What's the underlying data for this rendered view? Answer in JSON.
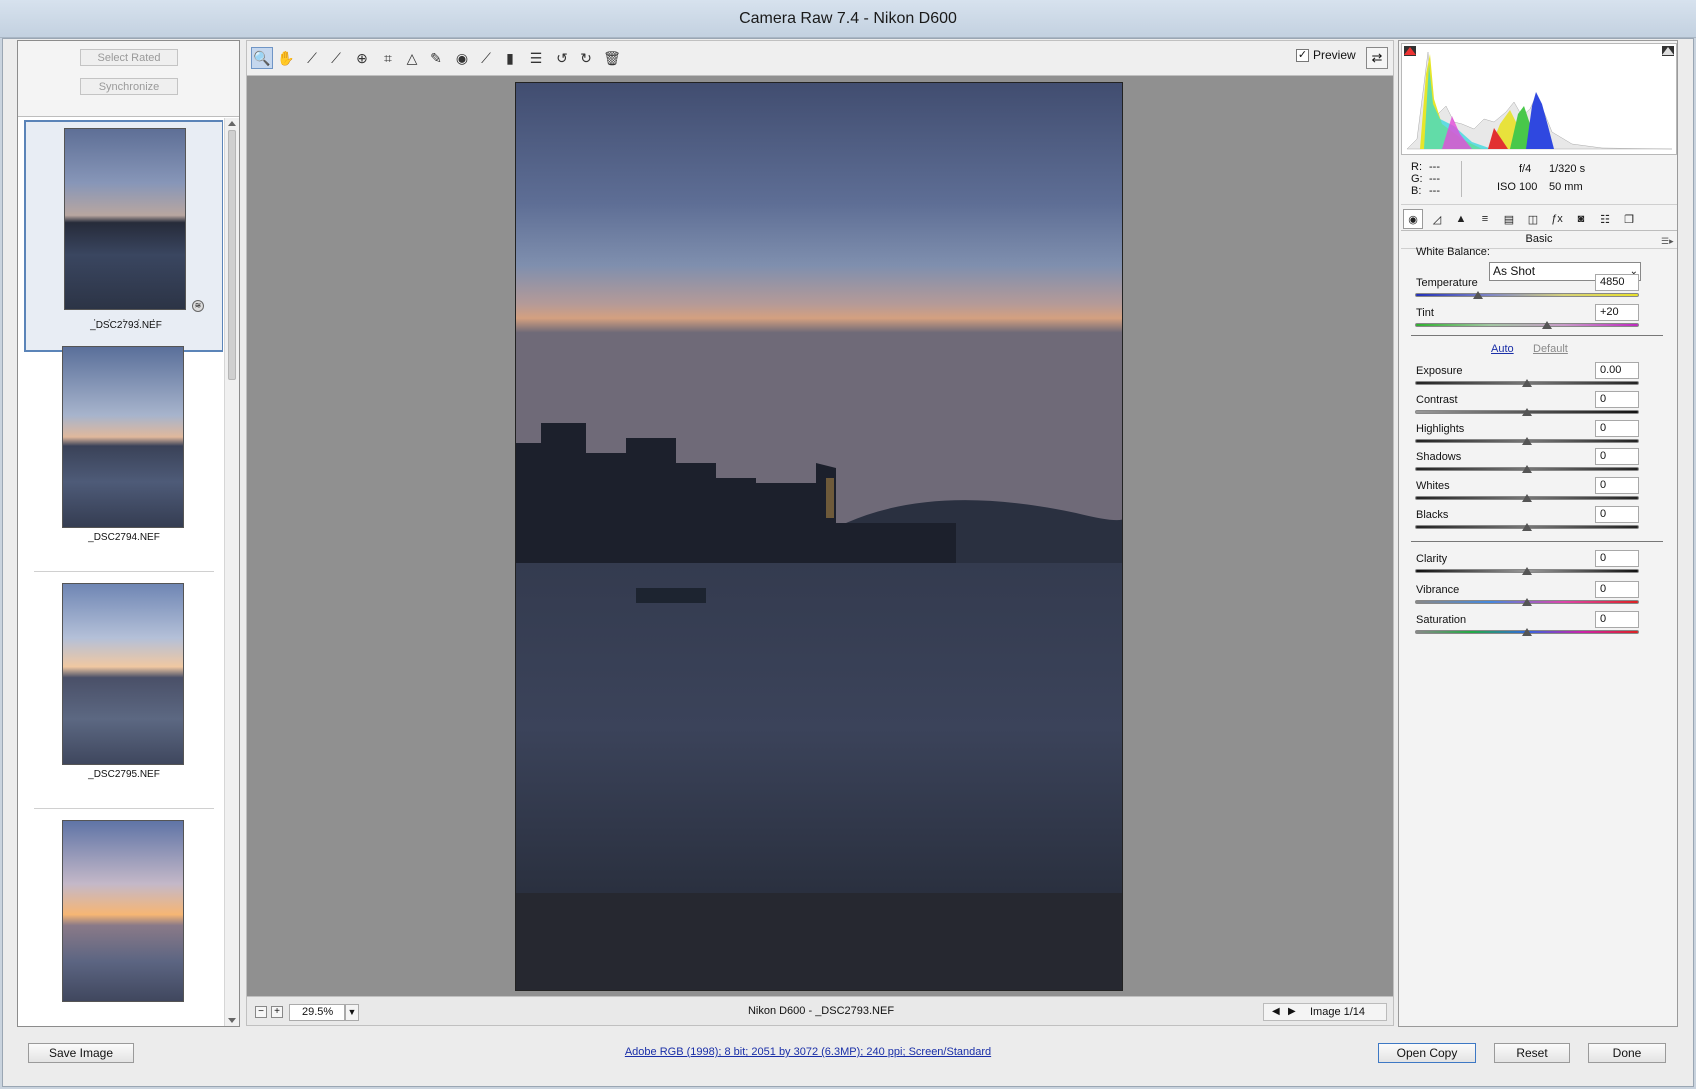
{
  "window": {
    "title": "Camera Raw 7.4  -  Nikon D600"
  },
  "filmstrip": {
    "select_rated_label": "Select Rated",
    "synchronize_label": "Synchronize",
    "items": [
      {
        "name": "_DSC2793.NEF",
        "rating": "· · · · ·",
        "selected": true
      },
      {
        "name": "_DSC2794.NEF",
        "selected": false
      },
      {
        "name": "_DSC2795.NEF",
        "selected": false
      },
      {
        "name": "",
        "selected": false
      }
    ]
  },
  "toolbar": {
    "tools": [
      "zoom-icon",
      "hand-icon",
      "white-balance-icon",
      "color-sampler-icon",
      "targeted-adjustment-icon",
      "crop-icon",
      "straighten-icon",
      "spot-removal-icon",
      "red-eye-icon",
      "adjustment-brush-icon",
      "graduated-filter-icon",
      "preferences-icon",
      "rotate-left-icon",
      "rotate-right-icon",
      "trash-icon"
    ],
    "preview_label": "Preview",
    "preview_checked": true
  },
  "status": {
    "zoom_value": "29.5%",
    "file_label": "Nikon D600  -  _DSC2793.NEF",
    "image_counter": "Image 1/14"
  },
  "info": {
    "r_label": "R:",
    "r_value": "---",
    "g_label": "G:",
    "g_value": "---",
    "b_label": "B:",
    "b_value": "---",
    "aperture": "f/4",
    "shutter": "1/320 s",
    "iso": "ISO 100",
    "focal": "50 mm"
  },
  "panel": {
    "title": "Basic",
    "white_balance_label": "White Balance:",
    "white_balance_value": "As Shot",
    "auto_label": "Auto",
    "default_label": "Default",
    "sliders": [
      {
        "key": "temperature",
        "label": "Temperature",
        "value": "4850",
        "pos": 0.28
      },
      {
        "key": "tint",
        "label": "Tint",
        "value": "+20",
        "pos": 0.59
      },
      {
        "key": "exposure",
        "label": "Exposure",
        "value": "0.00",
        "pos": 0.5
      },
      {
        "key": "contrast",
        "label": "Contrast",
        "value": "0",
        "pos": 0.5
      },
      {
        "key": "highlights",
        "label": "Highlights",
        "value": "0",
        "pos": 0.5
      },
      {
        "key": "shadows",
        "label": "Shadows",
        "value": "0",
        "pos": 0.5
      },
      {
        "key": "whites",
        "label": "Whites",
        "value": "0",
        "pos": 0.5
      },
      {
        "key": "blacks",
        "label": "Blacks",
        "value": "0",
        "pos": 0.5
      },
      {
        "key": "clarity",
        "label": "Clarity",
        "value": "0",
        "pos": 0.5
      },
      {
        "key": "vibrance",
        "label": "Vibrance",
        "value": "0",
        "pos": 0.5
      },
      {
        "key": "saturation",
        "label": "Saturation",
        "value": "0",
        "pos": 0.5
      }
    ]
  },
  "footer": {
    "save_label": "Save Image",
    "workflow_link": "Adobe RGB (1998); 8 bit; 2051 by 3072 (6.3MP); 240 ppi; Screen/Standard",
    "open_copy_label": "Open Copy",
    "reset_label": "Reset",
    "done_label": "Done"
  },
  "colors": {
    "accent": "#5b84b8",
    "link": "#1a2fa8",
    "canvas": "#909090"
  }
}
